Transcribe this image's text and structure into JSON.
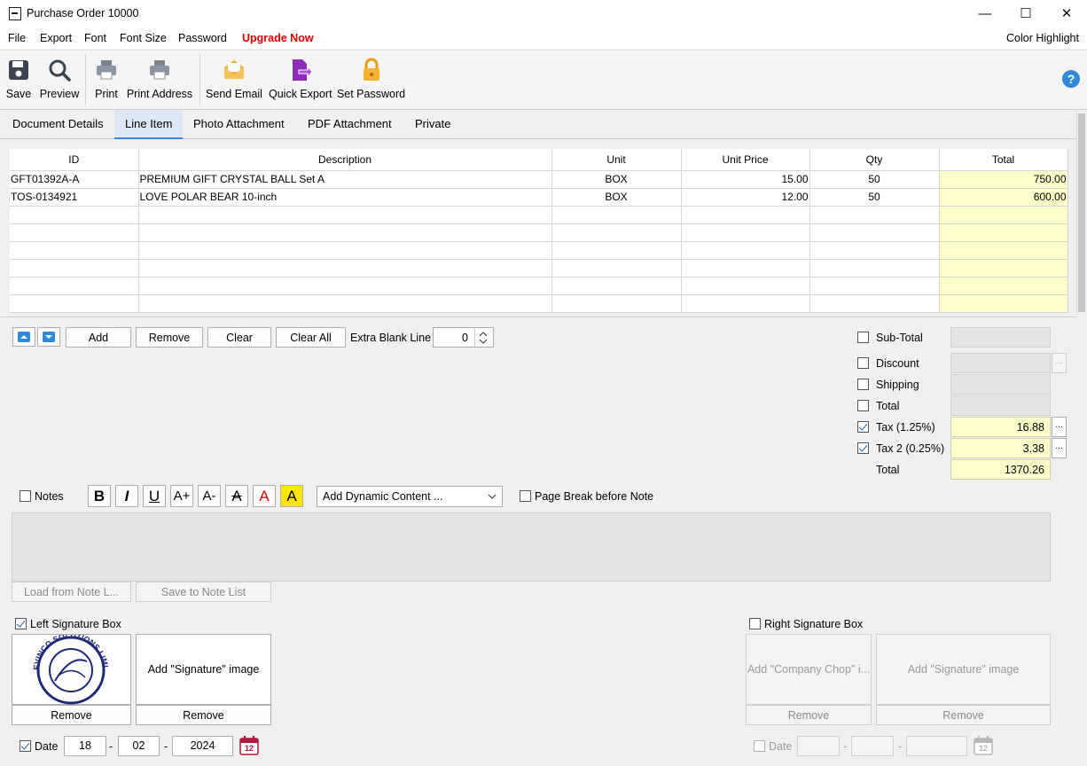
{
  "window": {
    "title": "Purchase Order 10000",
    "controls": {
      "minimize": "—",
      "maximize": "☐",
      "close": "✕"
    }
  },
  "menu": {
    "items": [
      "File",
      "Export",
      "Font",
      "Font Size",
      "Password",
      "Upgrade Now"
    ],
    "right": "Color Highlight"
  },
  "toolbar": {
    "buttons": [
      {
        "label": "Save",
        "icon": "save-icon"
      },
      {
        "label": "Preview",
        "icon": "magnifier-icon"
      },
      {
        "label": "Print",
        "icon": "printer-icon"
      },
      {
        "label": "Print Address",
        "icon": "printer-icon"
      },
      {
        "label": "Send Email",
        "icon": "envelope-icon"
      },
      {
        "label": "Quick Export",
        "icon": "export-document-icon"
      },
      {
        "label": "Set Password",
        "icon": "padlock-icon"
      }
    ],
    "help": "?"
  },
  "tabs": [
    "Document Details",
    "Line Item",
    "Photo Attachment",
    "PDF Attachment",
    "Private"
  ],
  "active_tab": "Line Item",
  "grid": {
    "columns": [
      "ID",
      "Description",
      "Unit",
      "Unit Price",
      "Qty",
      "Total"
    ],
    "rows": [
      [
        "GFT01392A-A",
        "PREMIUM GIFT CRYSTAL BALL Set A",
        "BOX",
        "15.00",
        "50",
        "750.00"
      ],
      [
        "TOS-0134921",
        "LOVE POLAR BEAR 10-inch",
        "BOX",
        "12.00",
        "50",
        "600.00"
      ],
      [
        "",
        "",
        "",
        "",
        "",
        ""
      ],
      [
        "",
        "",
        "",
        "",
        "",
        ""
      ],
      [
        "",
        "",
        "",
        "",
        "",
        ""
      ],
      [
        "",
        "",
        "",
        "",
        "",
        ""
      ],
      [
        "",
        "",
        "",
        "",
        "",
        ""
      ],
      [
        "",
        "",
        "",
        "",
        "",
        ""
      ]
    ]
  },
  "line_actions": {
    "add": "Add",
    "remove": "Remove",
    "clear": "Clear",
    "clear_all": "Clear All",
    "extra_blank_label": "Extra Blank Line",
    "extra_blank_value": "0"
  },
  "summary": {
    "subtotal_label": "Sub-Total",
    "discount_label": "Discount",
    "shipping_label": "Shipping",
    "total_label": "Total",
    "tax_label": "Tax (1.25%)",
    "tax_value": "16.88",
    "tax2_label": "Tax 2 (0.25%)",
    "tax2_value": "3.38",
    "grand_total_label": "Total",
    "grand_total_value": "1370.26",
    "ellipsis": "..."
  },
  "notes": {
    "label": "Notes",
    "dynamic_content": "Add Dynamic Content ...",
    "page_break": "Page Break before Note",
    "load": "Load from Note L...",
    "save": "Save to Note List",
    "format_glyphs": {
      "bold": "B",
      "italic": "I",
      "underline": "U",
      "grow": "A+",
      "shrink": "A-",
      "strike": "A",
      "color": "A",
      "highlight": "A"
    }
  },
  "signature": {
    "left_label": "Left Signature Box",
    "left_sig_image": "Add \"Signature\" image",
    "remove": "Remove",
    "stamp_text": "EVINCO SOLUTIONS LIMITED",
    "right_label": "Right Signature Box",
    "company_chop": "Add \"Company Chop\" i...",
    "right_sig_image": "Add \"Signature\" image"
  },
  "date": {
    "label": "Date",
    "day": "18",
    "month": "02",
    "year": "2024",
    "sep": "-",
    "cal_glyph": "12"
  },
  "colors": {
    "accent": "#2e89d8",
    "upgrade": "#e00000",
    "total_cell": "#ffffcc"
  }
}
